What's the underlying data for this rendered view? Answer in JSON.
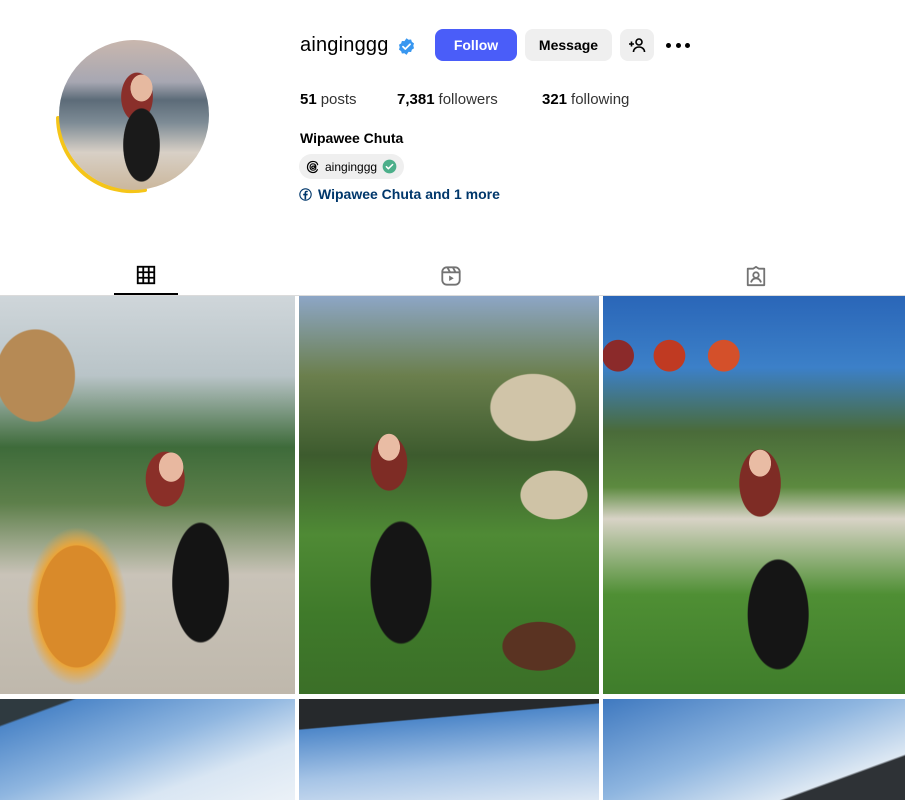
{
  "profile": {
    "username": "ainginggg",
    "verified": true,
    "full_name": "Wipawee Chuta",
    "threads_handle": "ainginggg",
    "facebook_link": "Wipawee Chuta and 1 more"
  },
  "actions": {
    "follow_label": "Follow",
    "message_label": "Message"
  },
  "stats": {
    "posts_count": "51",
    "posts_label": "posts",
    "followers_count": "7,381",
    "followers_label": "followers",
    "following_count": "321",
    "following_label": "following"
  },
  "tabs": [
    {
      "name": "posts",
      "icon": "grid-icon",
      "active": true
    },
    {
      "name": "reels",
      "icon": "reels-icon",
      "active": false
    },
    {
      "name": "tagged",
      "icon": "tagged-icon",
      "active": false
    }
  ],
  "colors": {
    "follow_button": "#4a5df9",
    "verified_badge": "#3897f0",
    "threads_check": "#4caf8a",
    "link": "#00376b",
    "story_ring": "#f5c518"
  }
}
